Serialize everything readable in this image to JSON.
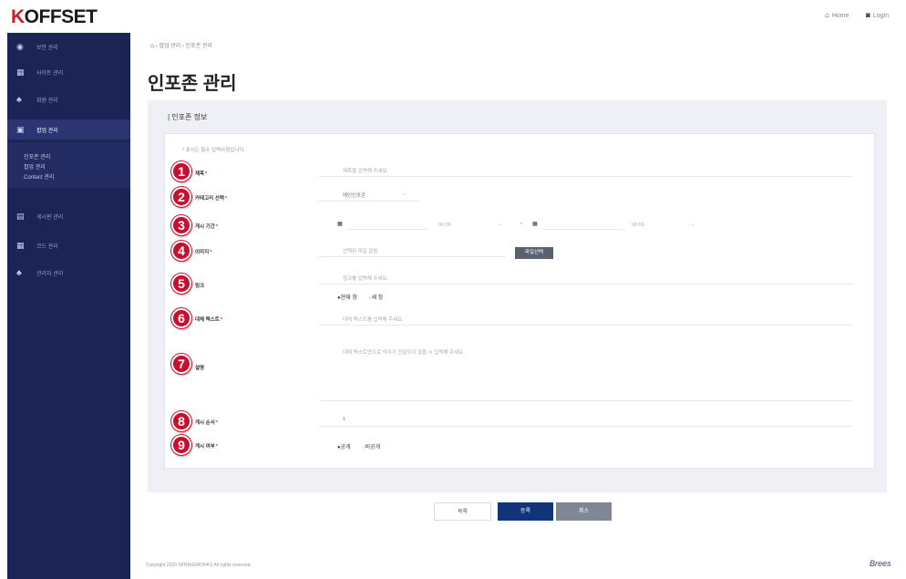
{
  "header": {
    "logo": "KOFFSET",
    "home_link": "Home",
    "logout_link": "Login"
  },
  "sidebar": {
    "items": [
      {
        "label": "보안 관리",
        "icon": "shield-icon"
      },
      {
        "label": "사이트 관리",
        "icon": "grid-icon"
      },
      {
        "label": "회원 관리",
        "icon": "users-icon"
      },
      {
        "label": "팝업 관리",
        "icon": "window-icon"
      },
      {
        "label": "게시판 관리",
        "icon": "board-icon"
      },
      {
        "label": "코드 관리",
        "icon": "code-icon"
      },
      {
        "label": "관리자 관리",
        "icon": "admin-icon"
      }
    ],
    "active_index": 3,
    "submenu": [
      "인포존 관리",
      "팝업 관리",
      "Contact 관리"
    ]
  },
  "breadcrumb": "› 팝업 관리 › 인포존 관리",
  "page_title": "인포존 관리",
  "section_title": "| 인포존 정보",
  "form_note": "* 표시는 필수 입력사항입니다.",
  "form": {
    "title": {
      "label": "제목",
      "placeholder": "제목을 입력해 주세요."
    },
    "category": {
      "label": "카테고리 선택",
      "value": "메인인포존"
    },
    "period": {
      "label": "게시 기간",
      "time1": "00:00",
      "time2": "00:00",
      "separator": "~"
    },
    "image": {
      "label": "이미지",
      "placeholder": "선택된 파일 없음",
      "button": "파일선택"
    },
    "link": {
      "label": "링크",
      "placeholder": "링크를 입력해 주세요.",
      "options": [
        "현재 창",
        "새 창"
      ]
    },
    "alt": {
      "label": "대체 텍스트",
      "placeholder": "대체 텍스트를 입력해 주세요."
    },
    "description": {
      "label": "설명",
      "placeholder": "대체 텍스트만으로 의미가 전달되지 않을 시 입력해 주세요."
    },
    "order": {
      "label": "게시 순서",
      "value": "1"
    },
    "publish": {
      "label": "게시 여부",
      "options": [
        "공개",
        "비공개"
      ]
    }
  },
  "buttons": {
    "list": "목록",
    "save": "등록",
    "cancel": "취소"
  },
  "footer": {
    "copyright": "Copyright 2020 SPRINGWORKS All rights reserved.",
    "brand": "Brees"
  },
  "colors": {
    "sidebar": "#1c2455",
    "badge": "#c8102e",
    "primary": "#12357a",
    "logo_accent": "#d11a2a"
  }
}
